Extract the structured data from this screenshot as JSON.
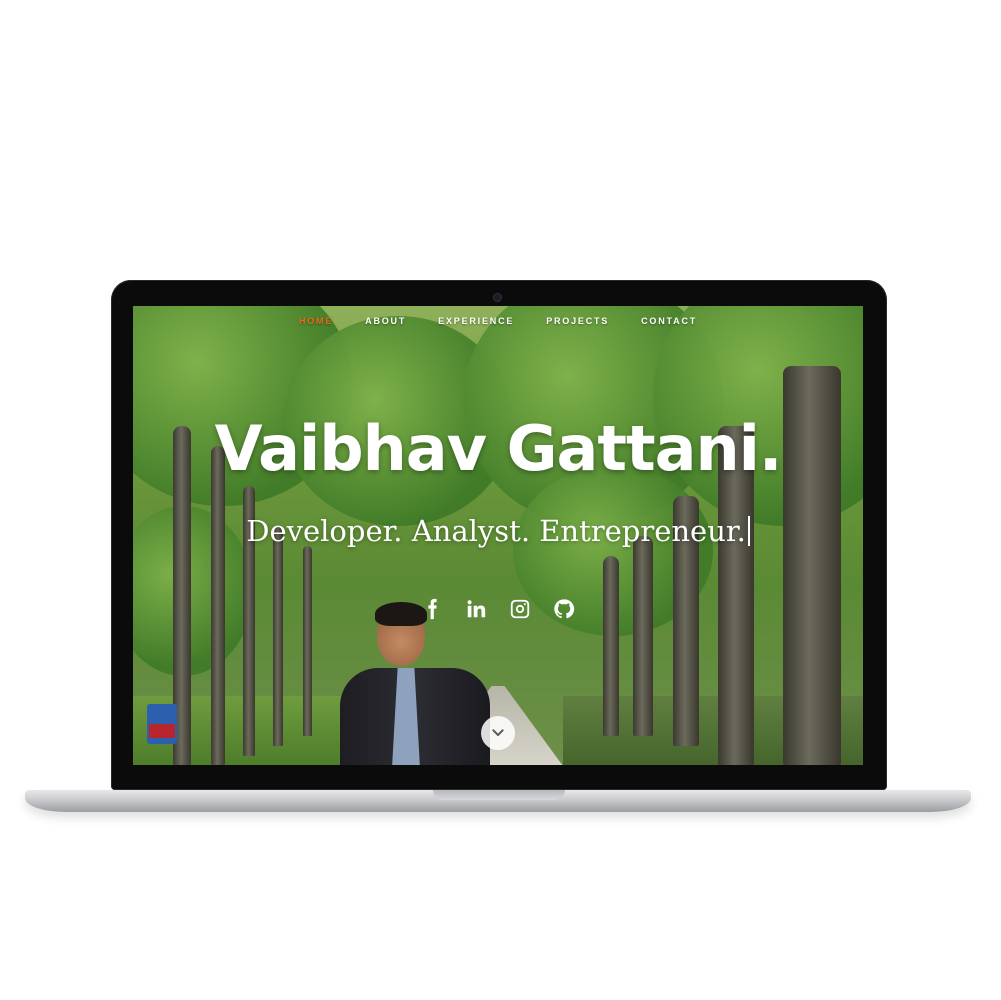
{
  "nav": {
    "items": [
      {
        "label": "HOME",
        "active": true
      },
      {
        "label": "ABOUT",
        "active": false
      },
      {
        "label": "EXPERIENCE",
        "active": false
      },
      {
        "label": "PROJECTS",
        "active": false
      },
      {
        "label": "CONTACT",
        "active": false
      }
    ]
  },
  "hero": {
    "name": "Vaibhav Gattani.",
    "tagline": "Developer. Analyst. Entrepreneur."
  },
  "social": {
    "icons": [
      "facebook-icon",
      "linkedin-icon",
      "instagram-icon",
      "github-icon"
    ]
  },
  "colors": {
    "accent": "#e7691d",
    "text": "#ffffff"
  }
}
